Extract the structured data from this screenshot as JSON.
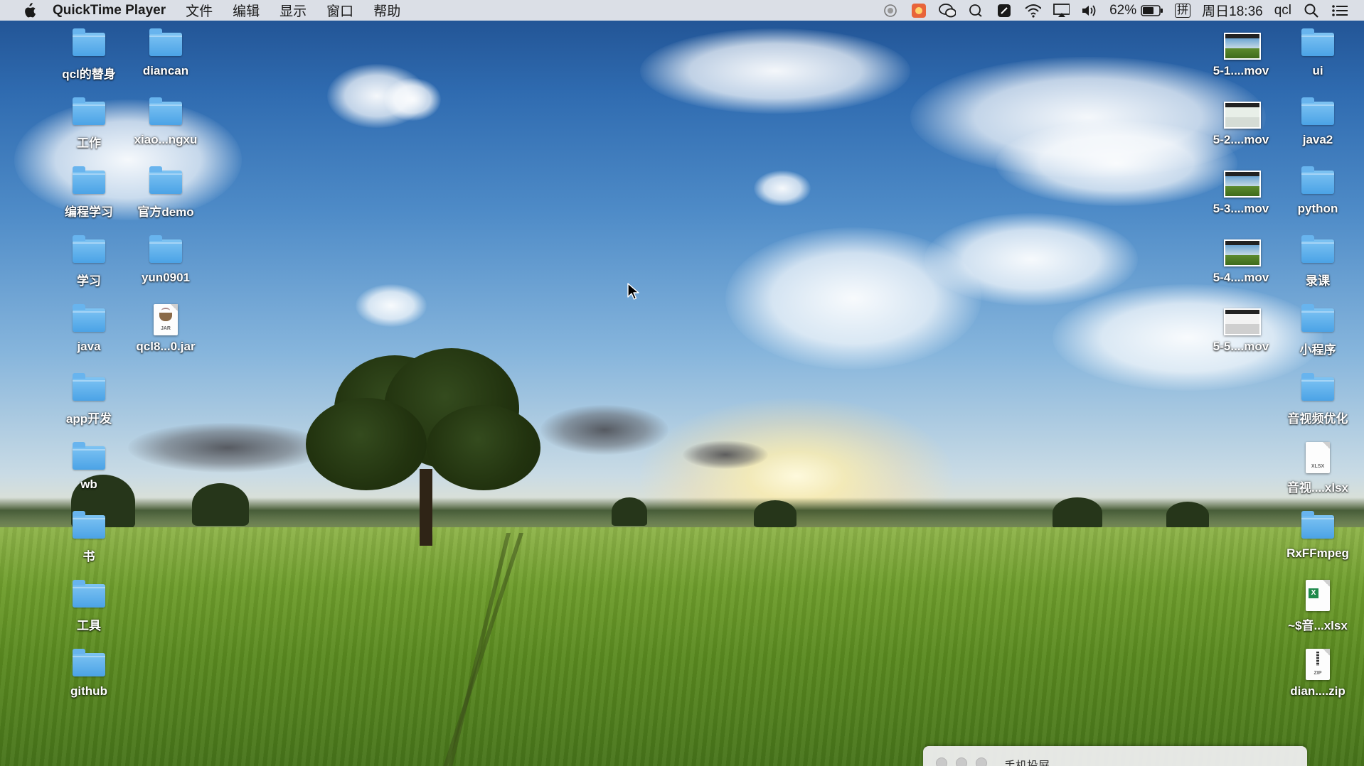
{
  "menubar": {
    "app_name": "QuickTime Player",
    "menus": [
      "文件",
      "编辑",
      "显示",
      "窗口",
      "帮助"
    ],
    "battery": "62%",
    "input_method": "拼",
    "clock": "周日18:36",
    "user": "qcl"
  },
  "desktop": {
    "left_col1": [
      "qcl的替身",
      "工作",
      "编程学习",
      "学习",
      "java",
      "app开发",
      "wb",
      "书",
      "工具",
      "github"
    ],
    "left_col2": [
      "diancan",
      "xiao...ngxu",
      "官方demo",
      "yun0901",
      "qcl8...0.jar"
    ],
    "right_col1": [
      "5-1....mov",
      "5-2....mov",
      "5-3....mov",
      "5-4....mov",
      "5-5....mov"
    ],
    "right_col2": [
      "ui",
      "java2",
      "python",
      "录课",
      "小程序",
      "音视频优化",
      "音视....xlsx",
      "RxFFmpeg",
      "~$音...xlsx",
      "dian....zip"
    ]
  },
  "window": {
    "title": "手机投屏"
  },
  "colors": {
    "folder": "#4ba3e6",
    "menubar": "#ececee"
  }
}
